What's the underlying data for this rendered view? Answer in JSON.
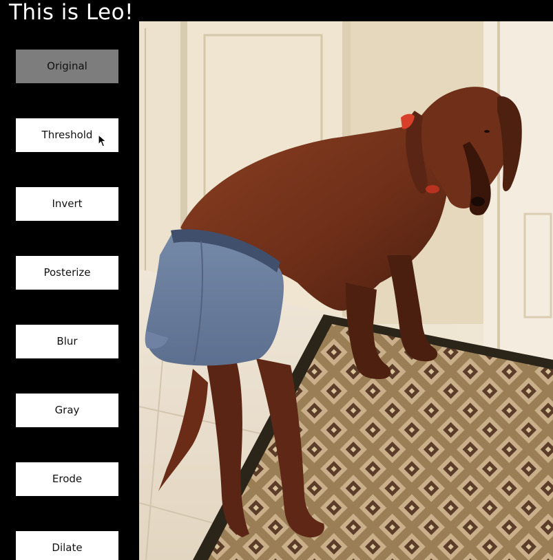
{
  "app": {
    "title": "This is Leo!"
  },
  "filters": [
    {
      "id": "original",
      "label": "Original",
      "selected": true
    },
    {
      "id": "threshold",
      "label": "Threshold",
      "selected": false
    },
    {
      "id": "invert",
      "label": "Invert",
      "selected": false
    },
    {
      "id": "posterize",
      "label": "Posterize",
      "selected": false
    },
    {
      "id": "blur",
      "label": "Blur",
      "selected": false
    },
    {
      "id": "gray",
      "label": "Gray",
      "selected": false
    },
    {
      "id": "erode",
      "label": "Erode",
      "selected": false
    },
    {
      "id": "dilate",
      "label": "Dilate",
      "selected": false
    }
  ],
  "colors": {
    "background": "#000000",
    "button_bg": "#ffffff",
    "button_selected_bg": "#7d7d7d",
    "title_text": "#ffffff"
  },
  "image": {
    "subject": "dog"
  }
}
